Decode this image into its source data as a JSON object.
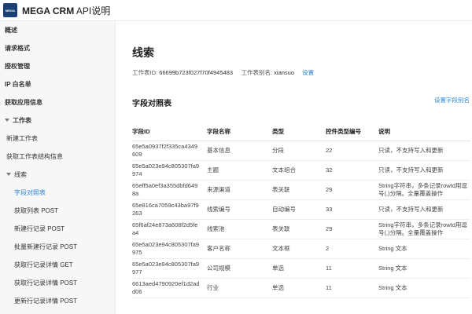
{
  "app": {
    "logo_text": "MEGA",
    "title_bold": "MEGA CRM",
    "title_rest": " API说明"
  },
  "sidebar": {
    "items": [
      {
        "label": "概述",
        "style": "bold"
      },
      {
        "label": "请求格式",
        "style": "bold"
      },
      {
        "label": "授权管理",
        "style": "bold"
      },
      {
        "label": "IP 白名单",
        "style": "bold"
      },
      {
        "label": "获取应用信息",
        "style": "bold"
      },
      {
        "label": "工作表",
        "style": "bold",
        "expanded": true
      },
      {
        "label": "新建工作表",
        "style": "lvl2"
      },
      {
        "label": "获取工作表结构信息",
        "style": "lvl2"
      },
      {
        "label": "线索",
        "style": "lvl2",
        "expanded": true
      },
      {
        "label": "字段对照表",
        "style": "lvl3",
        "active": true
      },
      {
        "label": "获取列表 POST",
        "style": "lvl3"
      },
      {
        "label": "新建行记录 POST",
        "style": "lvl3"
      },
      {
        "label": "批量新建行记录 POST",
        "style": "lvl3"
      },
      {
        "label": "获取行记录详情 GET",
        "style": "lvl3"
      },
      {
        "label": "获取行记录详情 POST",
        "style": "lvl3"
      },
      {
        "label": "更新行记录详情 POST",
        "style": "lvl3"
      }
    ]
  },
  "main": {
    "title": "线索",
    "worksheet_id_label": "工作表ID:",
    "worksheet_id": "66699b723f027f70f4945483",
    "alias_label": "工作表别名:",
    "alias": "xiansuo",
    "alias_link": "设置",
    "section_title": "字段对照表",
    "section_link": "设置字段别名",
    "table": {
      "headers": [
        "字段ID",
        "字段名称",
        "类型",
        "控件类型编号",
        "说明"
      ],
      "rows": [
        [
          "65e5a0937f2f335ca4349609",
          "基本信息",
          "分段",
          "22",
          "只读，不支持写入和更新"
        ],
        [
          "65e5a023e94c805307fa9974",
          "主题",
          "文本组合",
          "32",
          "只读，不支持写入和更新"
        ],
        [
          "65eff5a0ef3a355dbfd6498a",
          "来源渠道",
          "表关联",
          "29",
          "String字符串，多条记录rowId用逗号(,)分隔。全量覆盖操作"
        ],
        [
          "65e816ca7059c43ba97f9263",
          "线索编号",
          "自动编号",
          "33",
          "只读，不支持写入和更新"
        ],
        [
          "65f6af24e873a608f2d5fea4",
          "线索池",
          "表关联",
          "29",
          "String字符串，多条记录rowId用逗号(,)分隔。全量覆盖操作"
        ],
        [
          "65e5a023e94c805307fa9975",
          "客户名称",
          "文本框",
          "2",
          "String 文本"
        ],
        [
          "65e5a023e94c805307fa9977",
          "公司规模",
          "单选",
          "11",
          "String 文本"
        ],
        [
          "6613aed4790920ef1d2add06",
          "行业",
          "单选",
          "11",
          "String 文本"
        ]
      ]
    }
  },
  "colors": {
    "accent": "#2f86d6",
    "logo_bg": "#1a3f73",
    "sidebar_bg": "#f7f7f7"
  }
}
